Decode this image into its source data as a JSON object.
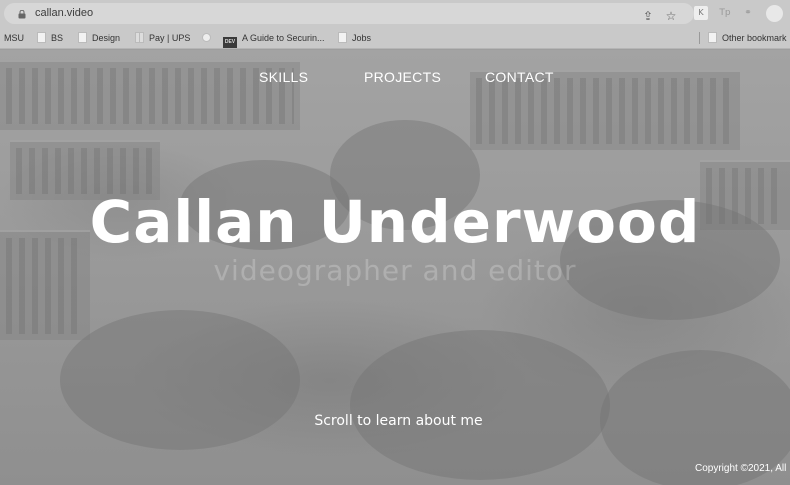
{
  "browser": {
    "url": "callan.video",
    "bookmarks": [
      {
        "label": "MSU",
        "icon": "none"
      },
      {
        "label": "BS",
        "icon": "page-icon"
      },
      {
        "label": "Design",
        "icon": "page-icon"
      },
      {
        "label": "Pay | UPS",
        "icon": "grid-icon"
      },
      {
        "label": "",
        "icon": "dot-icon"
      },
      {
        "label": "A Guide to Securin...",
        "icon": "dev-icon"
      },
      {
        "label": "Jobs",
        "icon": "page-icon"
      }
    ],
    "other_bookmarks": "Other bookmark",
    "dev_badge": "DEV"
  },
  "nav": {
    "skills": "SKILLS",
    "projects": "PROJECTS",
    "contact": "CONTACT"
  },
  "hero": {
    "title": "Callan Underwood",
    "subtitle": "videographer and editor",
    "scroll_hint": "Scroll to learn about me",
    "copyright": "Copyright ©2021, All"
  }
}
